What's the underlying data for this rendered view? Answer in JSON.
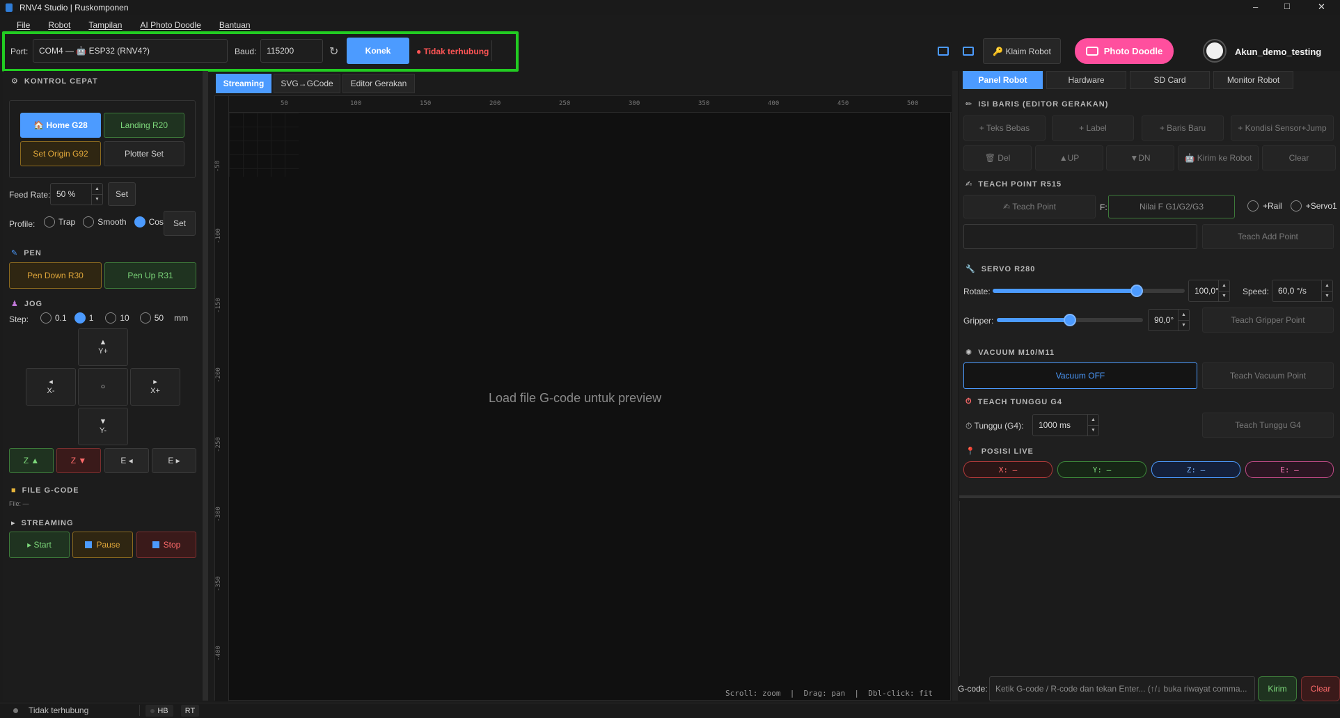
{
  "window": {
    "title": "RNV4 Studio | Ruskomponen",
    "controls": {
      "minimize": "–",
      "maximize": "□",
      "close": "✕"
    }
  },
  "menu": [
    "File",
    "Robot",
    "Tampilan",
    "AI Photo Doodle",
    "Bantuan"
  ],
  "connection": {
    "port_label": "Port:",
    "port_value": "COM4 — 🤖 ESP32 (RNV4?)",
    "baud_label": "Baud:",
    "baud_value": "115200",
    "connect_label": "Konek",
    "status": "● Tidak terhubung",
    "accent": "#4c9bff",
    "status_color": "#ff5555",
    "highlight_color": "#22cc22"
  },
  "topright": {
    "claim_label": "🔑 Klaim Robot",
    "doodle_label": "Photo Doodle",
    "account_name": "Akun_demo_testing",
    "doodle_color": "#ff4f9e"
  },
  "left": {
    "quick_title": "KONTROL CEPAT",
    "home_label": "🏠 Home  G28",
    "landing_label": "Landing  R20",
    "set_origin_label": "Set Origin  G92",
    "plotter_set_label": "Plotter Set",
    "feed_label": "Feed Rate:",
    "feed_value": "50 %",
    "feed_set": "Set",
    "profile_label": "Profile:",
    "profile_options": [
      "Trap",
      "Smooth",
      "Cos"
    ],
    "profile_selected": "Cos",
    "profile_set": "Set",
    "pen_title": "PEN",
    "pen_down": "Pen Down  R30",
    "pen_up": "Pen Up  R31",
    "jog_title": "JOG",
    "step_label": "Step:",
    "step_options": [
      "0.1",
      "1",
      "10",
      "50"
    ],
    "step_selected": "1",
    "step_unit": "mm",
    "jog": {
      "y_plus": "Y+",
      "y_minus": "Y-",
      "x_minus": "X-",
      "x_plus": "X+",
      "center": "○"
    },
    "z_up": "Z ▲",
    "z_down": "Z ▼",
    "e_minus": "E ◂",
    "e_plus": "E ▸",
    "file_title": "FILE G-CODE",
    "file_value": "File: —",
    "stream_title": "STREAMING",
    "start": "▸ Start",
    "pause": "Pause",
    "stop": "Stop"
  },
  "center": {
    "tabs": [
      "Streaming",
      "SVG→GCode",
      "Editor Gerakan"
    ],
    "active_tab": "Streaming",
    "ruler_x": [
      "50",
      "100",
      "150",
      "200",
      "250",
      "300",
      "350",
      "400",
      "450",
      "500"
    ],
    "ruler_y": [
      "-50",
      "-100",
      "-150",
      "-200",
      "-250",
      "-300",
      "-350",
      "-400"
    ],
    "placeholder": "Load file G-code untuk preview",
    "hint": "Scroll: zoom  |  Drag: pan  |  Dbl-click: fit"
  },
  "right": {
    "tabs": [
      "Panel Robot",
      "Hardware",
      "SD Card",
      "Monitor Robot"
    ],
    "active_tab": "Panel Robot",
    "isi_title": "ISI BARIS  (EDITOR GERAKAN)",
    "row1": [
      "+ Teks Bebas",
      "+ Label",
      "+ Baris Baru",
      "+ Kondisi Sensor+Jump"
    ],
    "row2": [
      "🗑 Del",
      "▲UP",
      "▼DN",
      "🤖 Kirim ke Robot",
      "Clear"
    ],
    "teach_title": "TEACH POINT  R515",
    "teach_point": "✍ Teach Point",
    "f_label": "F:",
    "f_placeholder": "Nilai F G1/G2/G3",
    "rail_label": "+Rail",
    "servo1_label": "+Servo1",
    "teach_add": "Teach Add Point",
    "servo_title": "SERVO  R280",
    "rotate_label": "Rotate:",
    "rotate_value": "100,0°",
    "rotate_fraction": 0.75,
    "speed_label": "Speed:",
    "speed_value": "60,0 °/s",
    "gripper_label": "Gripper:",
    "gripper_value": "90,0°",
    "gripper_fraction": 0.5,
    "teach_gripper": "Teach Gripper Point",
    "vacuum_title": "VACUUM  M10/M11",
    "vacuum_btn": "Vacuum OFF",
    "teach_vacuum": "Teach Vacuum Point",
    "tunggu_title": "TEACH TUNGGU  G4",
    "tunggu_label": "⏱ Tunggu (G4):",
    "tunggu_value": "1000 ms",
    "teach_tunggu": "Teach Tunggu G4",
    "posisi_title": "POSISI LIVE",
    "pos": [
      "X: —",
      "Y: —",
      "Z: —",
      "E: —"
    ],
    "gcode_label": "G-code:",
    "gcode_placeholder": "Ketik G-code / R-code dan tekan Enter... (↑/↓ buka riwayat comma...",
    "send": "Kirim",
    "clear": "Clear"
  },
  "status": {
    "text": "Tidak terhubung",
    "hb": "HB",
    "rt": "RT"
  }
}
